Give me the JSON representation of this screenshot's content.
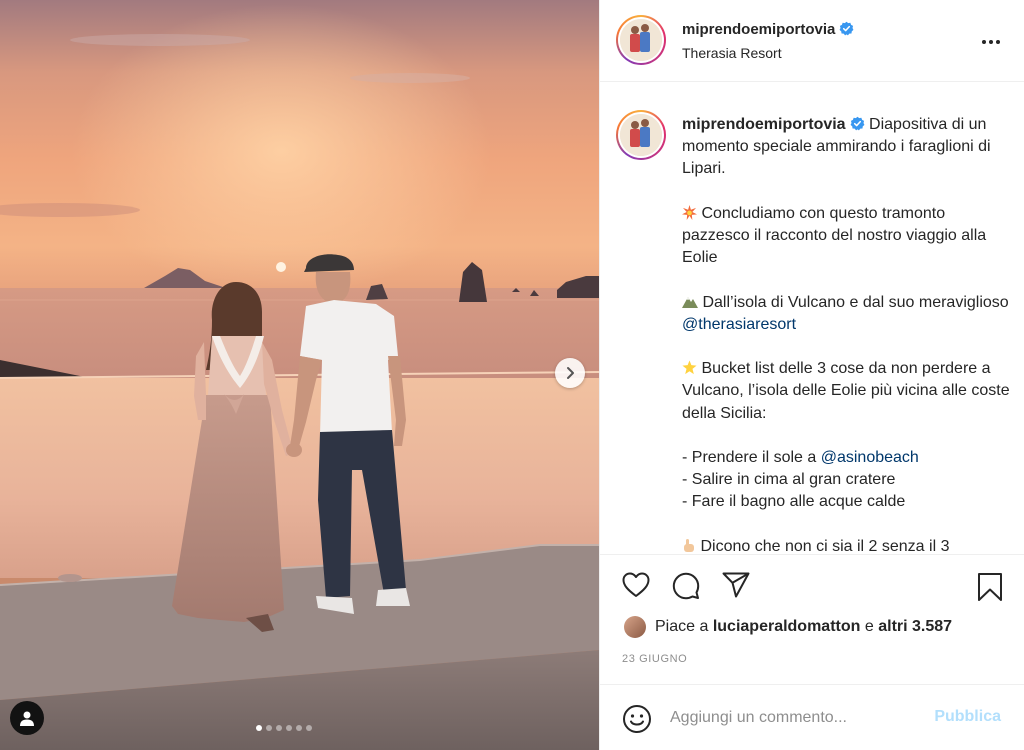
{
  "post": {
    "username": "miprendoemiportovia",
    "location": "Therasia Resort",
    "caption": {
      "username": "miprendoemiportovia",
      "intro": "Diapositiva di un momento speciale ammirando i faraglioni di Lipari.",
      "p1": "Concludiamo con questo tramonto pazzesco il racconto del nostro viaggio alla Eolie",
      "p2_before": "Dall’isola di Vulcano e dal suo meraviglioso ",
      "p2_mention": "@therasiaresort",
      "p3": "Bucket list delle 3 cose da non perdere a Vulcano, l’isola delle Eolie più vicina alle coste della Sicilia:",
      "list1_before": "- Prendere il sole a ",
      "list1_mention": "@asinobeach",
      "list2": "- Salire in cima al gran cratere",
      "list3": "- Fare il bagno alle acque calde",
      "p4_partial": "Dicono che non ci sia il 2 senza il 3"
    },
    "likes": {
      "prefix": "Piace a",
      "user": "luciaperaldomatton",
      "connector": "e",
      "others": "altri 3.587"
    },
    "date": "23 GIUGNO",
    "comment": {
      "placeholder": "Aggiungi un commento...",
      "publish_label": "Pubblica"
    },
    "carousel": {
      "total_slides": 6,
      "active_slide": 1
    }
  },
  "icons": {
    "verified": "verified-badge-icon",
    "more": "more-options-icon",
    "next": "chevron-right-icon",
    "user_tags": "user-tag-icon",
    "like": "heart-icon",
    "comment": "comment-bubble-icon",
    "share": "paper-plane-icon",
    "save": "bookmark-icon",
    "emoji": "smiley-icon"
  },
  "colors": {
    "verified": "#3897f0",
    "mention": "#00376b",
    "publish_disabled": "#b2dffc",
    "meta": "#8e8e8e"
  }
}
